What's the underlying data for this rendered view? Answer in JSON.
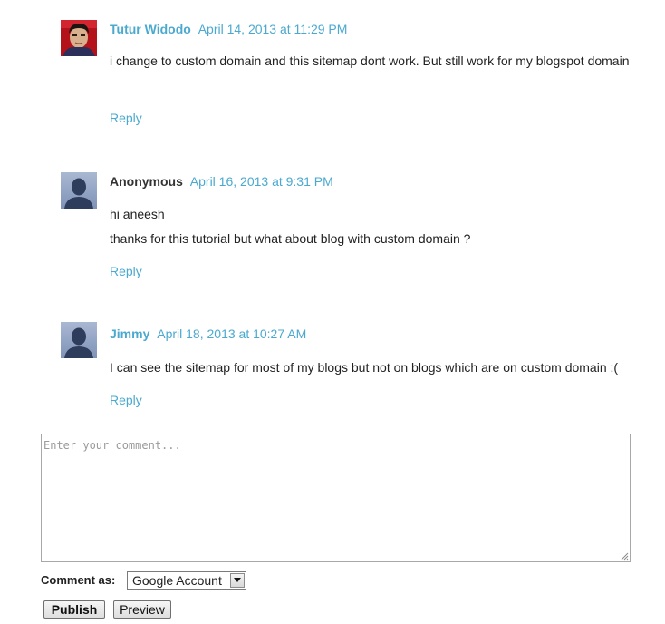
{
  "comments": [
    {
      "author": "Tutur Widodo",
      "date": "April 14, 2013 at 11:29 PM",
      "paragraphs": [
        "i change to custom domain and this sitemap dont work. But still work for my blogspot domain"
      ],
      "reply": "Reply",
      "avatar": "user-photo"
    },
    {
      "author": "Anonymous",
      "date": "April 16, 2013 at 9:31 PM",
      "paragraphs": [
        "hi aneesh",
        "thanks for this tutorial but what about blog with custom domain ?"
      ],
      "reply": "Reply",
      "avatar": "default-user-silhouette"
    },
    {
      "author": "Jimmy",
      "date": "April 18, 2013 at 10:27 AM",
      "paragraphs": [
        "I can see the sitemap for most of my blogs but not on blogs which are on custom domain :("
      ],
      "reply": "Reply",
      "avatar": "default-user-silhouette"
    }
  ],
  "form": {
    "placeholder": "Enter your comment...",
    "comment_as_label": "Comment as:",
    "comment_as_value": "Google Account",
    "publish_label": "Publish",
    "preview_label": "Preview"
  },
  "colors": {
    "link": "#4ba9cf",
    "text": "#222222"
  }
}
